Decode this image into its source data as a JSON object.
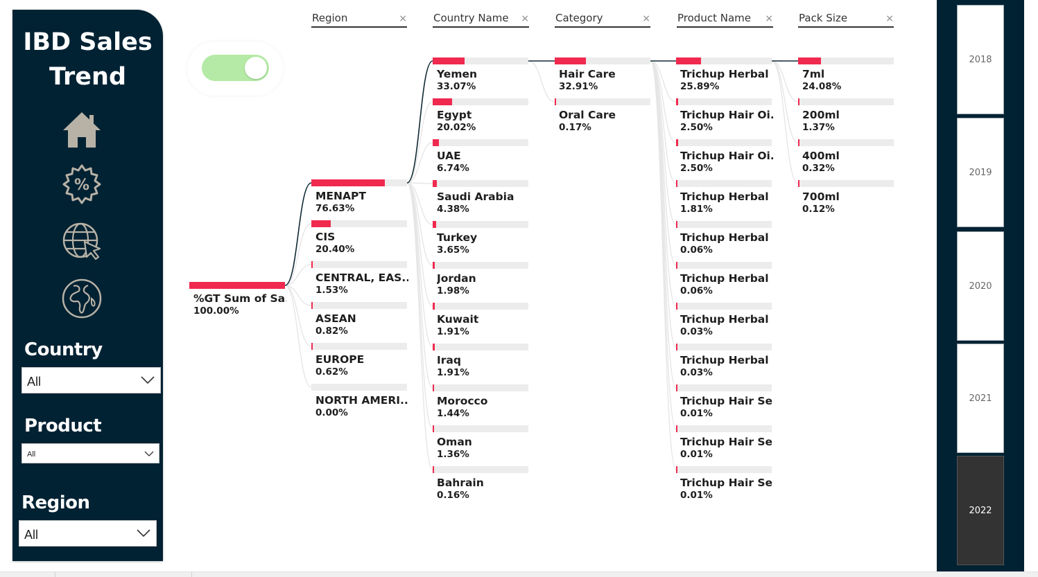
{
  "nav": {
    "title_line1": "IBD Sales",
    "title_line2": "Trend",
    "icons": [
      "home-icon",
      "discount-badge-icon",
      "globe-cursor-icon",
      "earth-icon"
    ],
    "filters": [
      {
        "label": "Country",
        "value": "All"
      },
      {
        "label": "Product",
        "value": "All"
      },
      {
        "label": "Region",
        "value": "All"
      }
    ]
  },
  "toggle": {
    "state": "on",
    "color": "#b4eaa5"
  },
  "tree": {
    "bar_color": "#f0294f",
    "track_color": "#ececec",
    "headers": [
      "Region",
      "Country Name",
      "Category",
      "Product Name",
      "Pack Size"
    ],
    "close_glyph": "×",
    "root": {
      "label": "%GT Sum of Sa...",
      "value": "100.00%",
      "fraction": 1.0
    },
    "columns": [
      {
        "name": "Region",
        "nodes": [
          {
            "label": "MENAPT",
            "value": "76.63%",
            "fraction": 0.7663
          },
          {
            "label": "CIS",
            "value": "20.40%",
            "fraction": 0.204
          },
          {
            "label": "CENTRAL, EAS...",
            "value": "1.53%",
            "fraction": 0.0153
          },
          {
            "label": "ASEAN",
            "value": "0.82%",
            "fraction": 0.0082
          },
          {
            "label": "EUROPE",
            "value": "0.62%",
            "fraction": 0.0062
          },
          {
            "label": "NORTH AMERI...",
            "value": "0.00%",
            "fraction": 0.0
          }
        ]
      },
      {
        "name": "Country Name",
        "nodes": [
          {
            "label": "Yemen",
            "value": "33.07%",
            "fraction": 0.3307
          },
          {
            "label": "Egypt",
            "value": "20.02%",
            "fraction": 0.2002
          },
          {
            "label": "UAE",
            "value": "6.74%",
            "fraction": 0.0674
          },
          {
            "label": "Saudi Arabia",
            "value": "4.38%",
            "fraction": 0.0438
          },
          {
            "label": "Turkey",
            "value": "3.65%",
            "fraction": 0.0365
          },
          {
            "label": "Jordan",
            "value": "1.98%",
            "fraction": 0.0198
          },
          {
            "label": "Kuwait",
            "value": "1.91%",
            "fraction": 0.0191
          },
          {
            "label": "Iraq",
            "value": "1.91%",
            "fraction": 0.0191
          },
          {
            "label": "Morocco",
            "value": "1.44%",
            "fraction": 0.0144
          },
          {
            "label": "Oman",
            "value": "1.36%",
            "fraction": 0.0136
          },
          {
            "label": "Bahrain",
            "value": "0.16%",
            "fraction": 0.0016
          }
        ]
      },
      {
        "name": "Category",
        "nodes": [
          {
            "label": "Hair Care",
            "value": "32.91%",
            "fraction": 0.3291
          },
          {
            "label": "Oral Care",
            "value": "0.17%",
            "fraction": 0.0017
          }
        ]
      },
      {
        "name": "Product Name",
        "nodes": [
          {
            "label": "Trichup Herbal ...",
            "value": "25.89%",
            "fraction": 0.2589
          },
          {
            "label": "Trichup Hair Oi...",
            "value": "2.50%",
            "fraction": 0.025
          },
          {
            "label": "Trichup Hair Oi...",
            "value": "2.50%",
            "fraction": 0.025
          },
          {
            "label": "Trichup Herbal ...",
            "value": "1.81%",
            "fraction": 0.0181
          },
          {
            "label": "Trichup Herbal ...",
            "value": "0.06%",
            "fraction": 0.0006
          },
          {
            "label": "Trichup Herbal ...",
            "value": "0.06%",
            "fraction": 0.0006
          },
          {
            "label": "Trichup Herbal ...",
            "value": "0.03%",
            "fraction": 0.0003
          },
          {
            "label": "Trichup Herbal ...",
            "value": "0.03%",
            "fraction": 0.0003
          },
          {
            "label": "Trichup Hair Se...",
            "value": "0.01%",
            "fraction": 0.0001
          },
          {
            "label": "Trichup Hair Se...",
            "value": "0.01%",
            "fraction": 0.0001
          },
          {
            "label": "Trichup Hair Se...",
            "value": "0.01%",
            "fraction": 0.0001
          }
        ]
      },
      {
        "name": "Pack Size",
        "nodes": [
          {
            "label": "7ml",
            "value": "24.08%",
            "fraction": 0.2408
          },
          {
            "label": "200ml",
            "value": "1.37%",
            "fraction": 0.0137
          },
          {
            "label": "400ml",
            "value": "0.32%",
            "fraction": 0.0032
          },
          {
            "label": "700ml",
            "value": "0.12%",
            "fraction": 0.0012
          }
        ]
      }
    ]
  },
  "years": {
    "items": [
      "2018",
      "2019",
      "2020",
      "2021",
      "2022"
    ],
    "selected": "2022"
  }
}
